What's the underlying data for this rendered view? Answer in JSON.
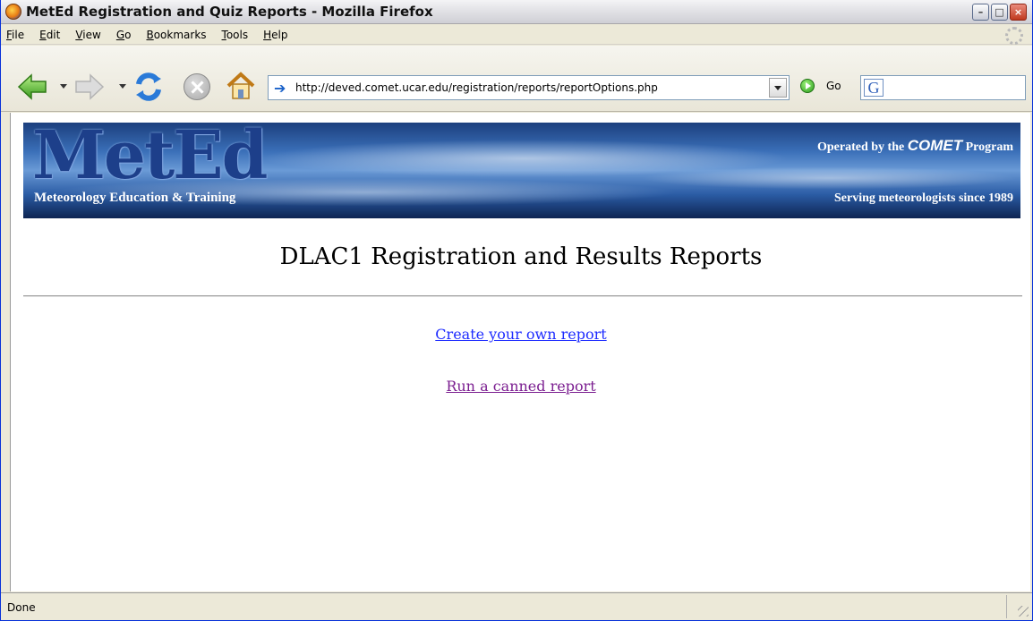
{
  "window": {
    "title": "MetEd Registration and Quiz Reports - Mozilla Firefox"
  },
  "menu": [
    {
      "label": "File",
      "ul": "F",
      "rest": "ile"
    },
    {
      "label": "Edit",
      "ul": "E",
      "rest": "dit"
    },
    {
      "label": "View",
      "ul": "V",
      "rest": "iew"
    },
    {
      "label": "Go",
      "ul": "G",
      "rest": "o"
    },
    {
      "label": "Bookmarks",
      "ul": "B",
      "rest": "ookmarks"
    },
    {
      "label": "Tools",
      "ul": "T",
      "rest": "ools"
    },
    {
      "label": "Help",
      "ul": "H",
      "rest": "elp"
    }
  ],
  "toolbar": {
    "url": "http://deved.comet.ucar.edu/registration/reports/reportOptions.php",
    "go_label": "Go",
    "search_value": ""
  },
  "banner": {
    "logo": "MetEd",
    "subtitle": "Meteorology Education & Training",
    "operated_prefix": "Operated by the",
    "operated_brand": "COMET",
    "operated_suffix": "Program",
    "serving": "Serving meteorologists since 1989"
  },
  "page": {
    "title": "DLAC1 Registration and Results Reports",
    "link_create": "Create your own report",
    "link_canned": "Run a canned report"
  },
  "status": {
    "text": "Done"
  },
  "colors": {
    "link": "#1e2cff",
    "visited_link": "#7b1e90"
  },
  "icons": [
    "back-arrow-icon",
    "forward-arrow-icon",
    "reload-icon",
    "stop-icon",
    "home-icon",
    "url-arrow-icon",
    "go-icon",
    "google-icon",
    "firefox-icon",
    "throbber-icon"
  ]
}
